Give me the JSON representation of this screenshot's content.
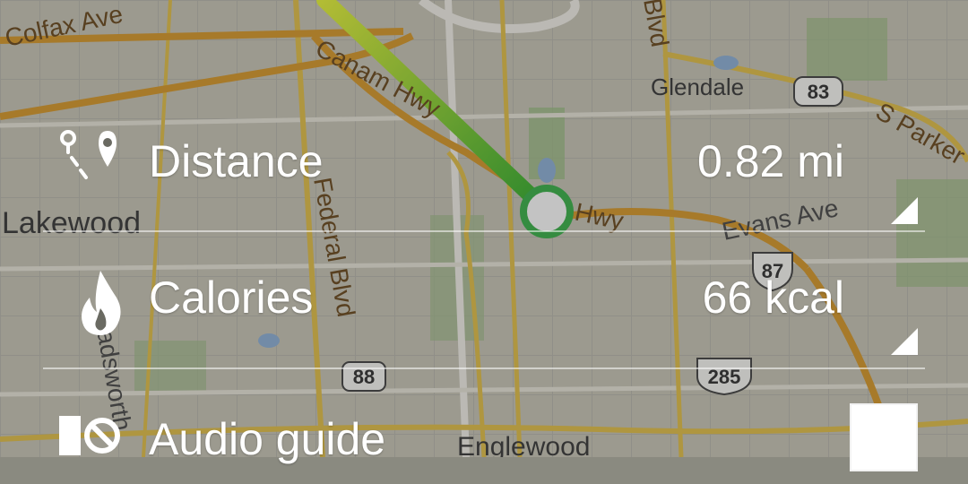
{
  "map": {
    "labels": {
      "colfax": "Colfax Ave",
      "canam": "Canam Hwy",
      "federal": "Federal Blvd",
      "evans": "Evans Ave",
      "parker": "S Parker",
      "wadsworth": "Wadsworth",
      "hwy": "Hwy",
      "blvd_top": "Blvd"
    },
    "cities": {
      "lakewood": "Lakewood",
      "glendale": "Glendale",
      "englewood": "Englewood"
    },
    "shields": {
      "r83": "83",
      "r87": "87",
      "r88": "88",
      "r285": "285"
    },
    "colors": {
      "route_start": "#e8f53a",
      "route_end": "#2fae2f",
      "marker_ring": "#3bb34a"
    }
  },
  "stats": {
    "distance": {
      "label": "Distance",
      "value": "0.82 mi",
      "icon": "route-pin-icon"
    },
    "calories": {
      "label": "Calories",
      "value": "66 kcal",
      "icon": "flame-icon"
    },
    "audio": {
      "label": "Audio guide",
      "icon": "audio-off-icon"
    }
  }
}
